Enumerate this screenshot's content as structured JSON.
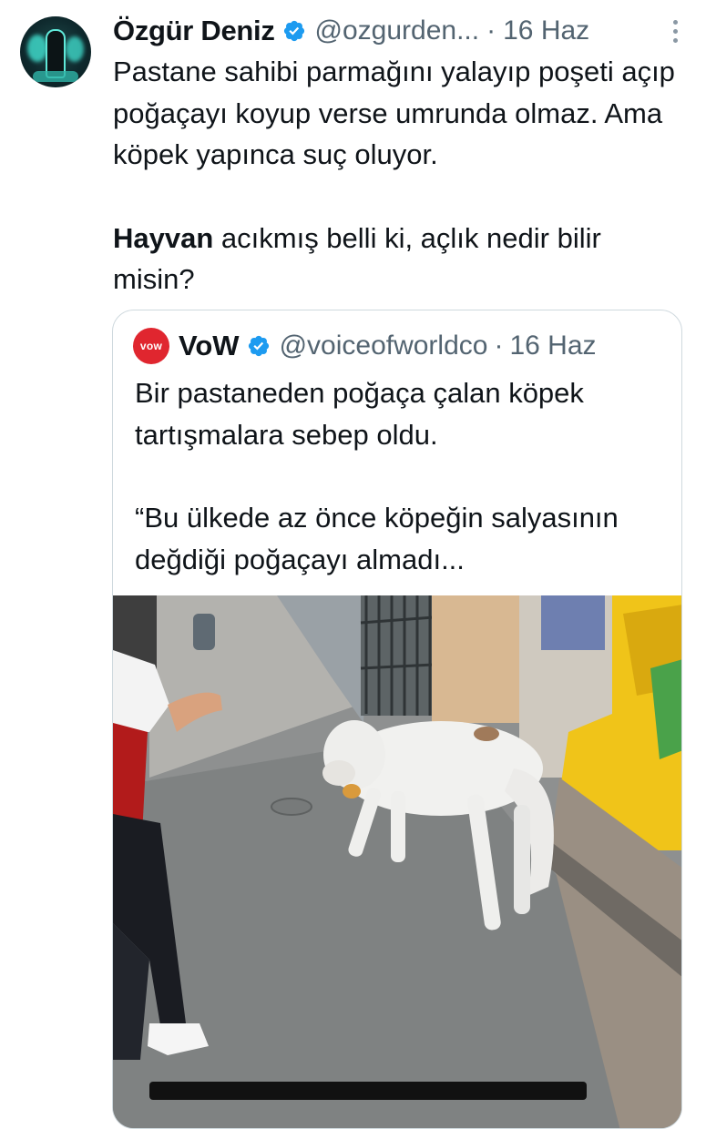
{
  "tweet": {
    "author_name": "Özgür Deniz",
    "handle": "@ozgurden...",
    "separator": "·",
    "date": "16 Haz",
    "text_para1": "Pastane sahibi parmağını yalayıp poşeti açıp poğaçayı koyup verse umrunda olmaz. Ama köpek yapınca suç oluyor.",
    "text_para2_bold": "Hayvan",
    "text_para2_rest": " acıkmış belli ki, açlık nedir bilir misin?"
  },
  "quoted": {
    "avatar_text": "vow",
    "author_name": "VoW",
    "handle": "@voiceofworldco",
    "separator": "·",
    "date": "16 Haz",
    "text_para1": "Bir pastaneden poğaça çalan köpek tartışmalara sebep oldu.",
    "text_para2": "“Bu ülkede az önce köpeğin salyasının değdiği poğaçayı almadı..."
  },
  "colors": {
    "verified": "#1d9bf0",
    "muted": "#536471",
    "text": "#0f1419",
    "border": "#cfd9de",
    "vow_red": "#e0262f"
  },
  "icons": [
    "verified-badge-icon",
    "more-options-icon"
  ]
}
